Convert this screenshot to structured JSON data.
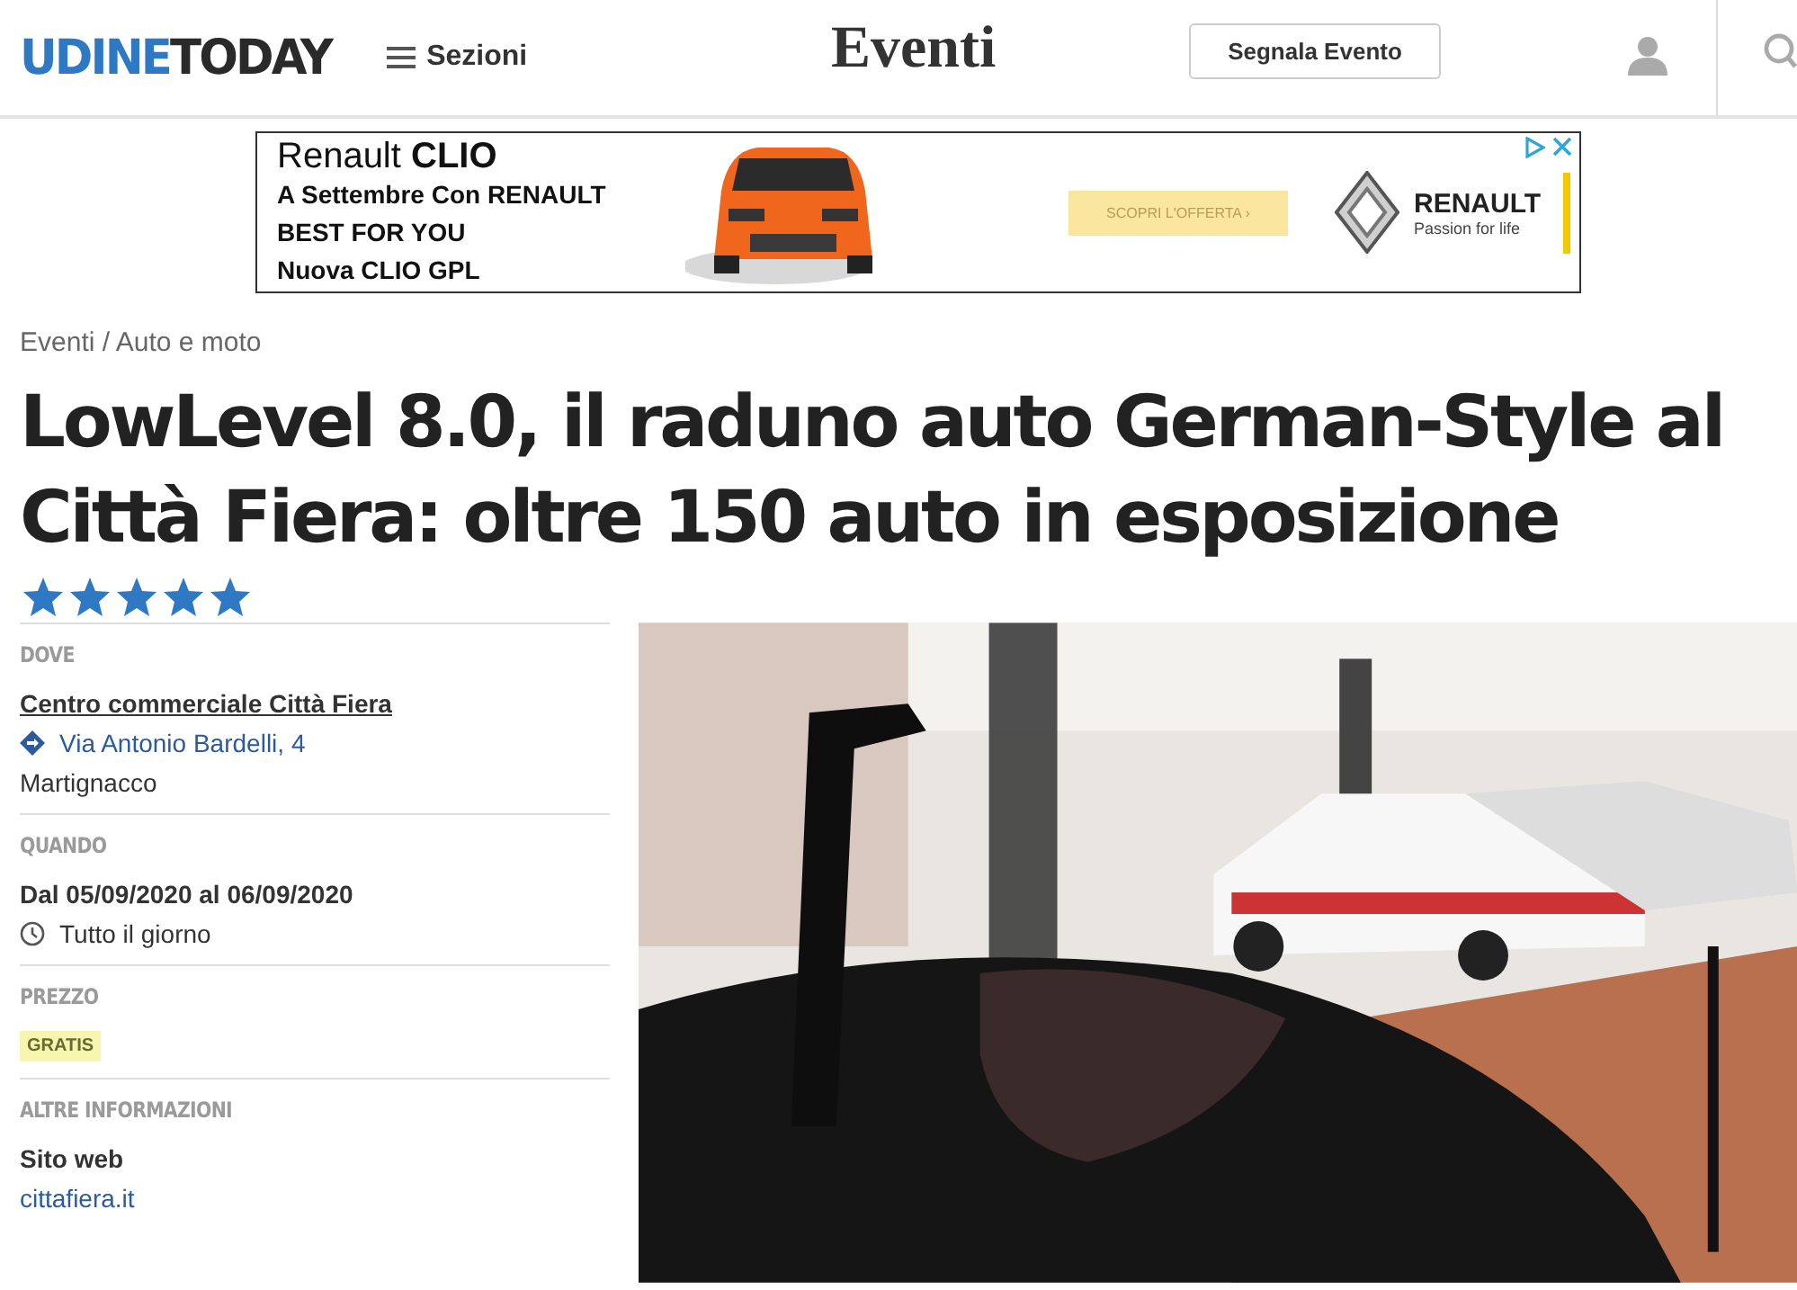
{
  "header": {
    "logo": {
      "first": "UDINE",
      "second": "TODAY"
    },
    "menu_label": "Sezioni",
    "section_title": "Eventi",
    "report_button": "Segnala Evento"
  },
  "ad": {
    "headline": {
      "plain": "Renault",
      "bold": "CLIO"
    },
    "lines": [
      "A Settembre Con RENAULT",
      "BEST FOR YOU",
      "Nuova CLIO GPL"
    ],
    "cta": "SCOPRI L'OFFERTA ›",
    "brand": "RENAULT",
    "tagline": "Passion for life",
    "car_image": {
      "kind": "picture"
    }
  },
  "breadcrumb": "Eventi / Auto e moto",
  "title": "LowLevel 8.0, il raduno auto German-Style al Città Fiera: oltre 150 auto in esposizione",
  "rating": {
    "stars": 5
  },
  "details": [
    {
      "heading": "DOVE",
      "items": [
        {
          "kind": "venue",
          "text": "Centro commerciale Città Fiera"
        },
        {
          "kind": "address",
          "text": "Via Antonio Bardelli, 4"
        },
        {
          "kind": "plain",
          "text": "Martignacco"
        }
      ]
    },
    {
      "heading": "QUANDO",
      "items": [
        {
          "kind": "strong",
          "text": "Dal 05/09/2020 al 06/09/2020"
        },
        {
          "kind": "time",
          "text": "Tutto il giorno"
        }
      ]
    },
    {
      "heading": "PREZZO",
      "items": [
        {
          "kind": "tag",
          "text": "GRATIS"
        }
      ]
    },
    {
      "heading": "ALTRE INFORMAZIONI",
      "items": [
        {
          "kind": "strong",
          "text": "Sito web"
        },
        {
          "kind": "link",
          "text": "cittafiera.it"
        }
      ]
    }
  ],
  "photo": {
    "kind": "picture"
  }
}
